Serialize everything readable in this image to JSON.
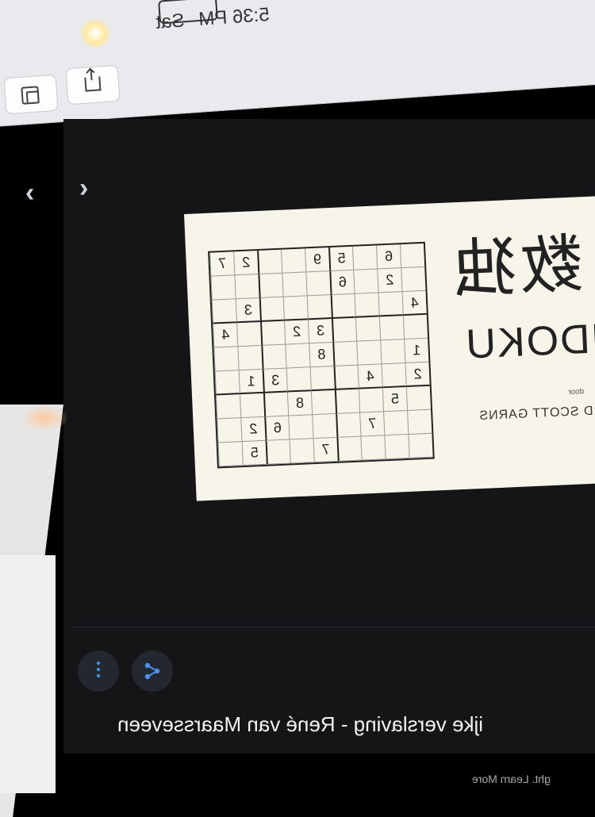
{
  "status_bar": {
    "time": "5:36 PM",
    "day": "Sat"
  },
  "toolbar": {
    "tabs_icon": "tabs-icon",
    "share_icon": "share-icon"
  },
  "video": {
    "nav_prev": "‹",
    "nav_next": "›"
  },
  "book": {
    "kanji": "数独",
    "title": "UDOKU",
    "by": "door",
    "author": "ARD SCOTT GARNS",
    "grid": [
      [
        "7",
        "2",
        "",
        "",
        "9",
        "5",
        "",
        "6",
        ""
      ],
      [
        "",
        "",
        "",
        "",
        "",
        "6",
        "",
        "2",
        ""
      ],
      [
        "",
        "3",
        "",
        "",
        "",
        "",
        "",
        "",
        "4"
      ],
      [
        "4",
        "",
        "",
        "2",
        "3",
        "",
        "",
        "",
        ""
      ],
      [
        "",
        "",
        "",
        "",
        "8",
        "",
        "",
        "",
        "1"
      ],
      [
        "",
        "1",
        "3",
        "",
        "",
        "",
        "4",
        "",
        "2"
      ],
      [
        "",
        "",
        "",
        "8",
        "",
        "",
        "",
        "5",
        ""
      ],
      [
        "",
        "2",
        "6",
        "",
        "",
        "",
        "7",
        "",
        ""
      ],
      [
        "",
        "5",
        "",
        "",
        "7",
        "",
        "",
        "",
        ""
      ]
    ]
  },
  "video_info": {
    "title": "ijke verslaving - René van Maarsseveen",
    "subtitle": "ght. Learn More"
  },
  "colors": {
    "accent": "#4f8fe8",
    "background": "#151517"
  }
}
